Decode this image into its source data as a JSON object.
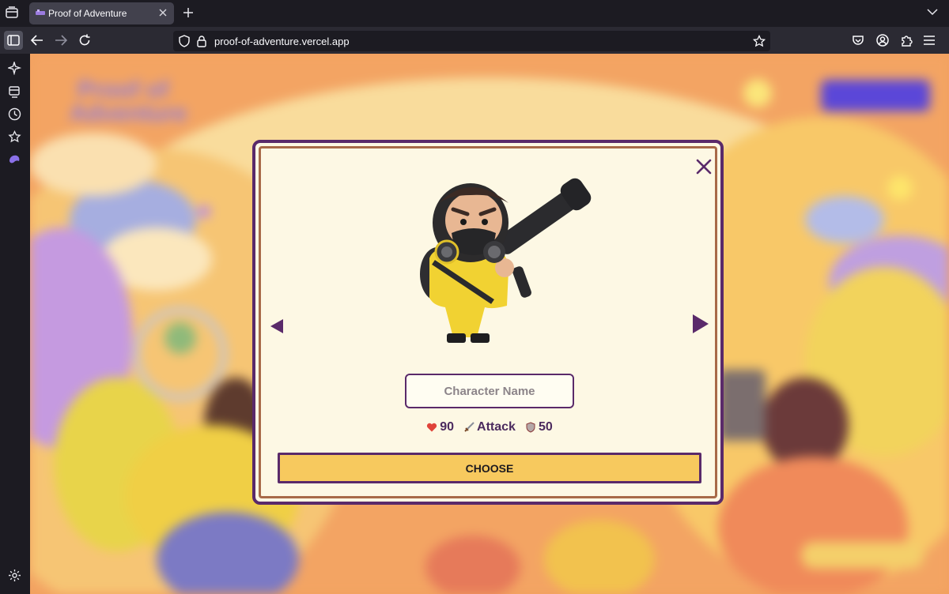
{
  "browser": {
    "tab_title": "Proof of Adventure",
    "url": "proof-of-adventure.vercel.app"
  },
  "modal": {
    "name_placeholder": "Character Name",
    "stats": {
      "health": "90",
      "attack": "Attack",
      "defense": "50"
    },
    "choose_label": "CHOOSE"
  },
  "icons": {
    "health": "heart-icon",
    "attack": "sword-icon",
    "defense": "shield-icon"
  },
  "colors": {
    "modal_border": "#5a2a6a",
    "modal_bg": "#fdf8e4",
    "button_bg": "#f7c95e",
    "accent_purple": "#4b2a5e"
  }
}
